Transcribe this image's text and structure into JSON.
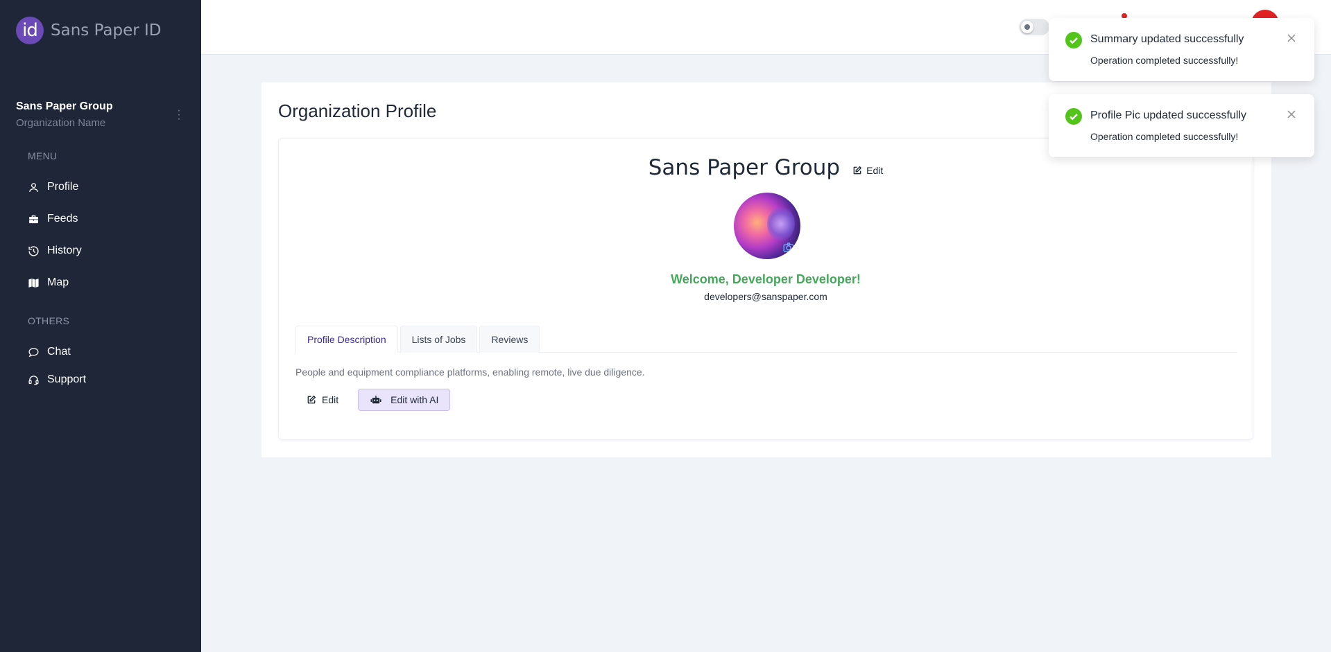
{
  "brand": {
    "logo_text": "id",
    "name": "Sans Paper ID"
  },
  "org": {
    "name": "Sans Paper Group",
    "subtitle": "Organization Name"
  },
  "sidebar": {
    "menu_label": "MENU",
    "others_label": "OTHERS",
    "items": [
      {
        "label": "Profile",
        "icon": "user-icon"
      },
      {
        "label": "Feeds",
        "icon": "briefcase-icon"
      },
      {
        "label": "History",
        "icon": "history-icon"
      },
      {
        "label": "Map",
        "icon": "map-icon"
      }
    ],
    "others": [
      {
        "label": "Chat",
        "icon": "chat-icon"
      },
      {
        "label": "Support",
        "icon": "headset-icon"
      }
    ]
  },
  "page": {
    "title": "Organization Profile",
    "org_title": "Sans Paper Group",
    "edit_label": "Edit",
    "welcome": "Welcome, Developer Developer!",
    "email": "developers@sanspaper.com",
    "tabs": [
      "Profile Description",
      "Lists of Jobs",
      "Reviews"
    ],
    "active_tab": "Profile Description",
    "description": "People and equipment compliance platforms, enabling remote, live due diligence.",
    "edit_button": "Edit",
    "ai_button": "Edit with AI"
  },
  "toasts": [
    {
      "title": "Summary updated successfully",
      "message": "Operation completed successfully!"
    },
    {
      "title": "Profile Pic updated successfully",
      "message": "Operation completed successfully!"
    }
  ],
  "colors": {
    "sidebar_bg": "#1e2637",
    "brand_accent": "#6b4ab8",
    "success": "#52c41a",
    "welcome_text": "#44a85a"
  }
}
